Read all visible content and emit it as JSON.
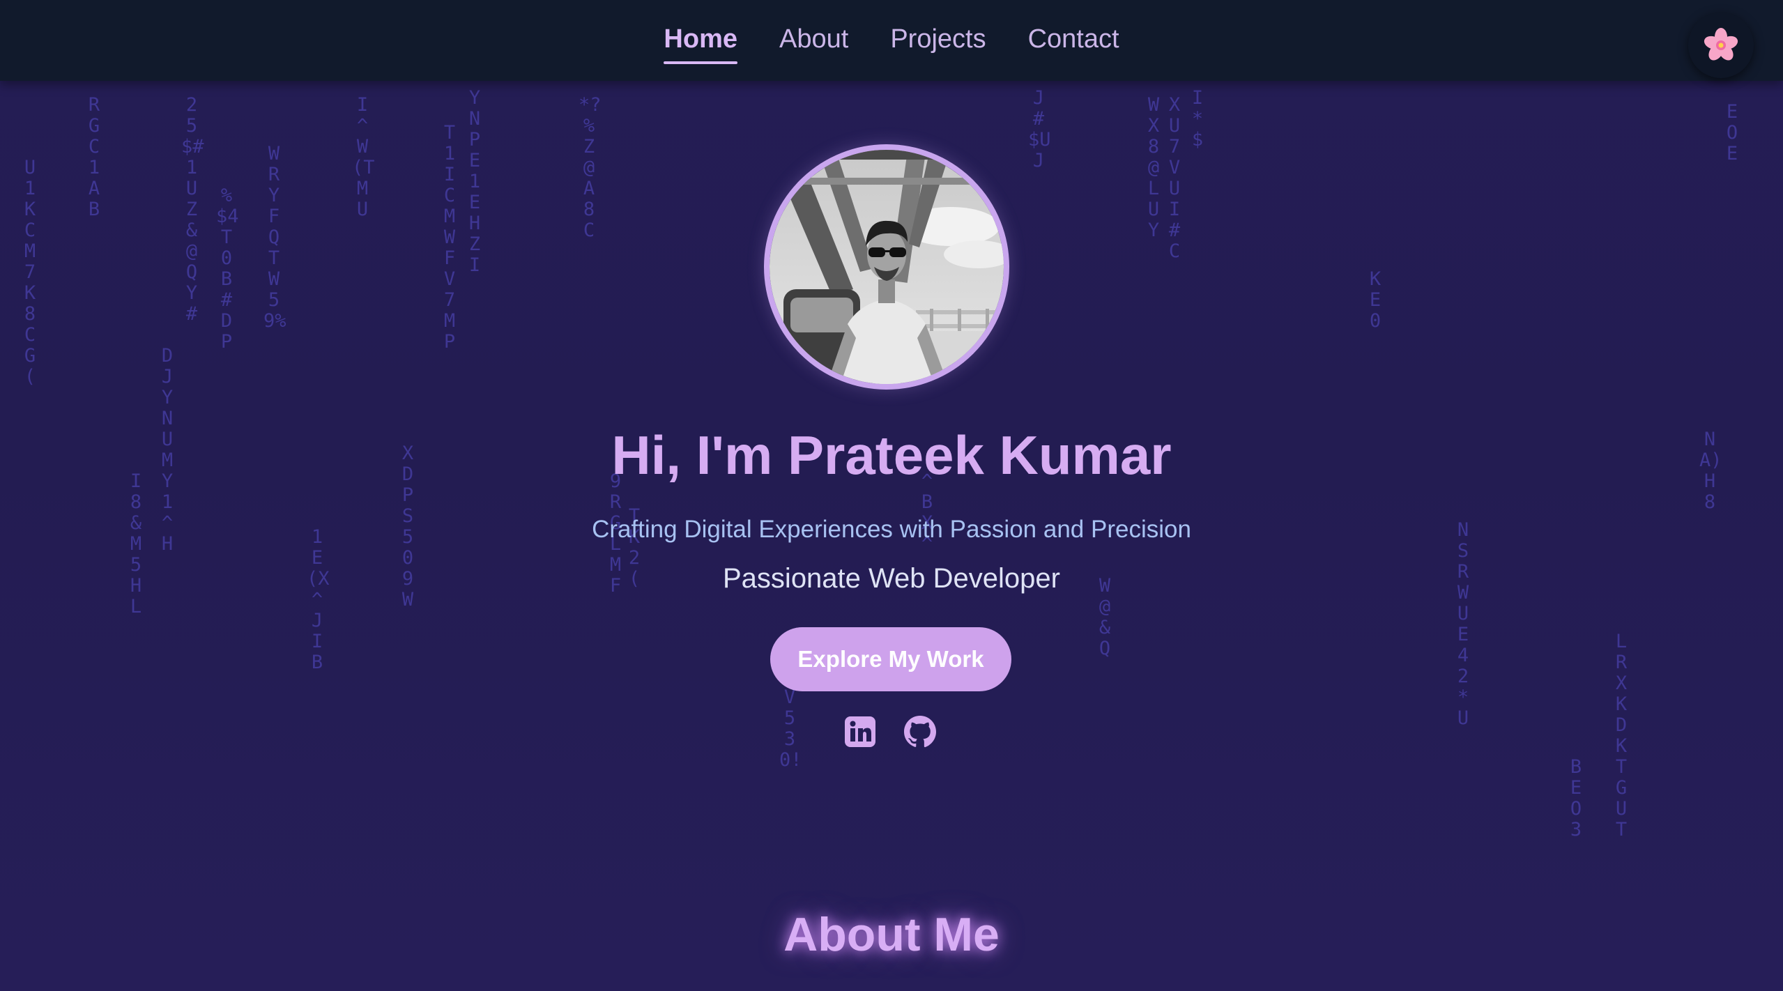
{
  "nav": {
    "items": [
      {
        "label": "Home",
        "active": true
      },
      {
        "label": "About",
        "active": false
      },
      {
        "label": "Projects",
        "active": false
      },
      {
        "label": "Contact",
        "active": false
      }
    ],
    "theme_toggle_icon": "🌸"
  },
  "hero": {
    "title": "Hi, I'm Prateek Kumar",
    "tagline": "Crafting Digital Experiences with Passion and Precision",
    "role": "Passionate Web Developer",
    "cta_label": "Explore My Work",
    "social_icons": [
      "linkedin-icon",
      "github-icon"
    ]
  },
  "about": {
    "heading": "About Me"
  },
  "colors": {
    "background": "#241d55",
    "nav_background": "#111a2c",
    "accent": "#d6acf2",
    "button": "#cea2ec",
    "tagline": "#a8c2f2",
    "rain": "#3f3794"
  }
}
